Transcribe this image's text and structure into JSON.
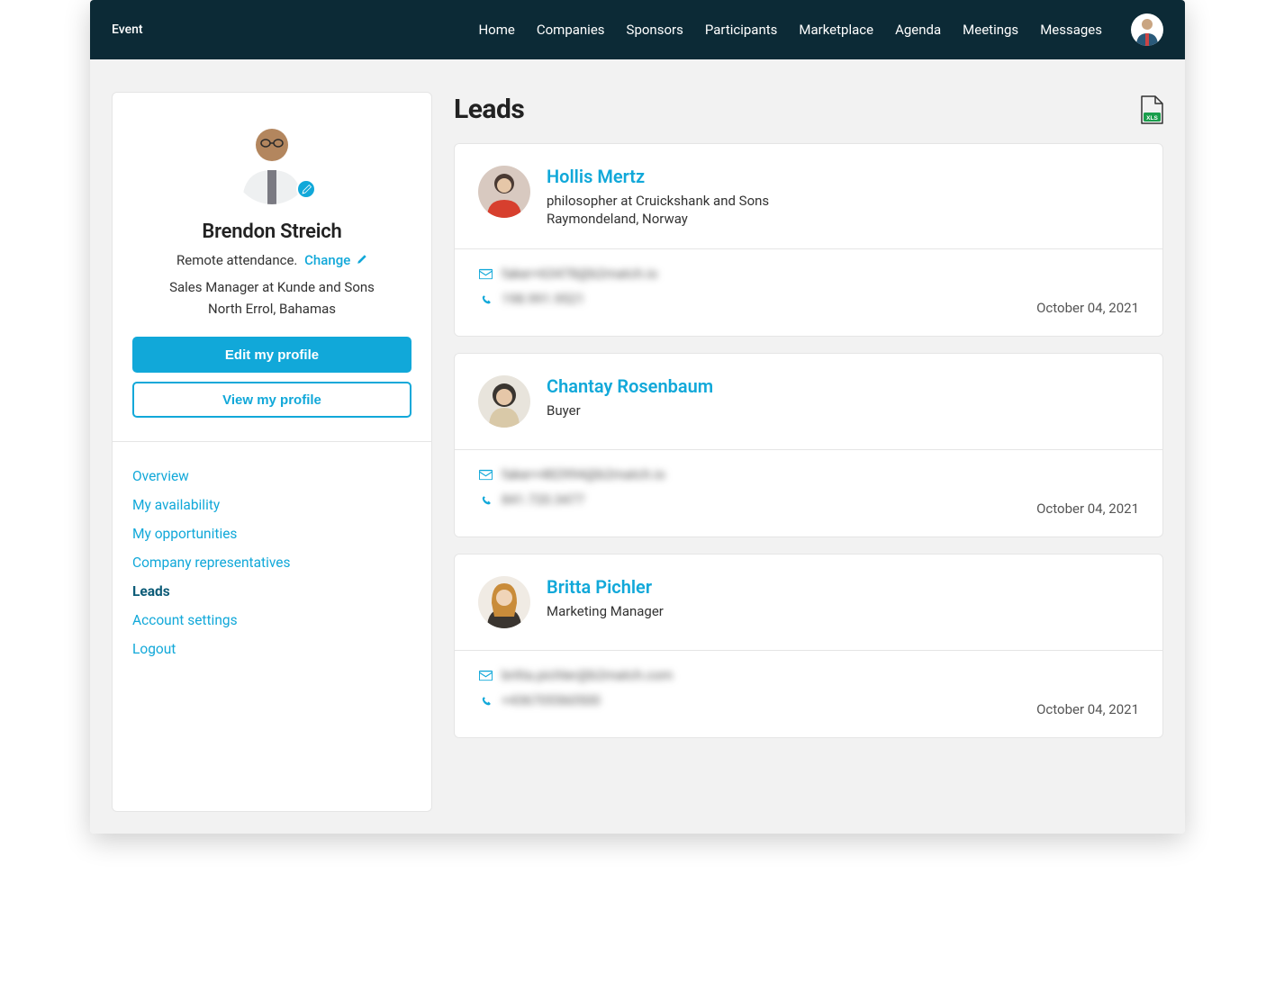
{
  "header": {
    "brand": "Event",
    "nav": [
      "Home",
      "Companies",
      "Sponsors",
      "Participants",
      "Marketplace",
      "Agenda",
      "Meetings",
      "Messages"
    ]
  },
  "profile": {
    "name": "Brendon Streich",
    "attendance_label": "Remote attendance.",
    "change_label": "Change",
    "role_line": "Sales Manager at Kunde and Sons",
    "location": "North Errol, Bahamas",
    "edit_btn": "Edit my profile",
    "view_btn": "View my profile"
  },
  "sidebar_menu": [
    {
      "label": "Overview",
      "active": false
    },
    {
      "label": "My availability",
      "active": false
    },
    {
      "label": "My opportunities",
      "active": false
    },
    {
      "label": "Company representatives",
      "active": false
    },
    {
      "label": "Leads",
      "active": true
    },
    {
      "label": "Account settings",
      "active": false
    },
    {
      "label": "Logout",
      "active": false
    }
  ],
  "page": {
    "title": "Leads"
  },
  "leads": [
    {
      "name": "Hollis Mertz",
      "sub": "philosopher at Cruickshank and Sons",
      "loc": "Raymondeland, Norway",
      "email": "faker+63478@b2match.io",
      "phone": "198.991.9521",
      "date": "October 04, 2021",
      "avatar_bg": "#d8c9c0"
    },
    {
      "name": "Chantay Rosenbaum",
      "sub": "Buyer",
      "loc": "",
      "email": "faker+482994@b2match.io",
      "phone": "841.720.3477",
      "date": "October 04, 2021",
      "avatar_bg": "#e8e4dc"
    },
    {
      "name": "Britta Pichler",
      "sub": "Marketing Manager",
      "loc": "",
      "email": "britta.pichler@b2match.com",
      "phone": "+436705560500",
      "date": "October 04, 2021",
      "avatar_bg": "#f0ebe4"
    }
  ]
}
